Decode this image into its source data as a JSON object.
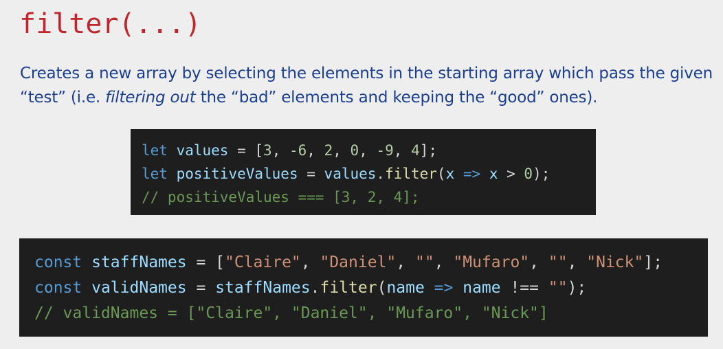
{
  "title": "filter(...)",
  "description": {
    "part1": "Creates a new array by selecting the elements in the starting array which pass the given “test” (i.e. ",
    "emphasis": "filtering out",
    "part2": " the “bad” elements and keeping the “good” ones)."
  },
  "code_block_1": {
    "line1": {
      "kw": "let",
      "name": "values",
      "op": " = ",
      "open": "[",
      "v1": "3",
      "v2": "-6",
      "v3": "2",
      "v4": "0",
      "v5": "-9",
      "v6": "4",
      "close": "];",
      "sep": ", "
    },
    "line2": {
      "kw": "let",
      "name": "positiveValues",
      "op": " = ",
      "obj": "values",
      "dot": ".",
      "method": "filter",
      "paren_open": "(",
      "param": "x",
      "arrow": " => ",
      "param2": "x",
      "gt": " > ",
      "zero": "0",
      "paren_close": ");"
    },
    "line3": {
      "comment": "// positiveValues === [3, 2, 4];"
    }
  },
  "code_block_2": {
    "line1": {
      "kw": "const",
      "name": "staffNames",
      "op": " = ",
      "open": "[",
      "s1": "\"Claire\"",
      "s2": "\"Daniel\"",
      "s3": "\"\"",
      "s4": "\"Mufaro\"",
      "s5": "\"\"",
      "s6": "\"Nick\"",
      "close": "];",
      "sep": ", "
    },
    "line2": {
      "kw": "const",
      "name": "validNames",
      "op": " = ",
      "obj": "staffNames",
      "dot": ".",
      "method": "filter",
      "paren_open": "(",
      "param": "name",
      "arrow": " => ",
      "param2": "name",
      "neq": " !== ",
      "empty": "\"\"",
      "paren_close": ");"
    },
    "line3": {
      "comment": "// validNames = [\"Claire\", \"Daniel\", \"Mufaro\", \"Nick\"]"
    }
  },
  "colors": {
    "title": "#c0272d",
    "description": "#1b3f8f",
    "code_background": "#1e1e1e",
    "keyword": "#569cd6",
    "variable": "#9cdcfe",
    "function": "#dcdcaa",
    "number": "#b5cea8",
    "string": "#ce9178",
    "comment": "#6a9955"
  }
}
